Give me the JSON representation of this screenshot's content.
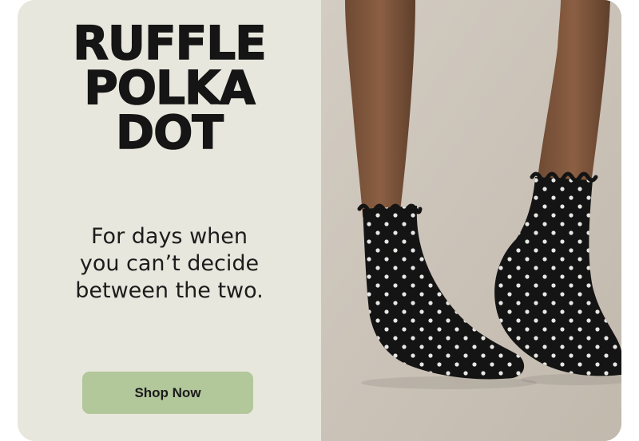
{
  "promo": {
    "title_lines": [
      "RUFFLE",
      "POLKA",
      "DOT"
    ],
    "subtitle_lines": [
      "For days when",
      "you can’t decide",
      "between the two."
    ],
    "cta_label": "Shop Now"
  },
  "image": {
    "subject": "product-photo-polka-dot-ruffle-socks"
  },
  "colors": {
    "panel_bg": "#e7e7dd",
    "title": "#151515",
    "button_bg": "#b2c79a",
    "photo_bg": "#cbc3b8",
    "sock": "#141414",
    "dot": "#f2f2ee"
  }
}
